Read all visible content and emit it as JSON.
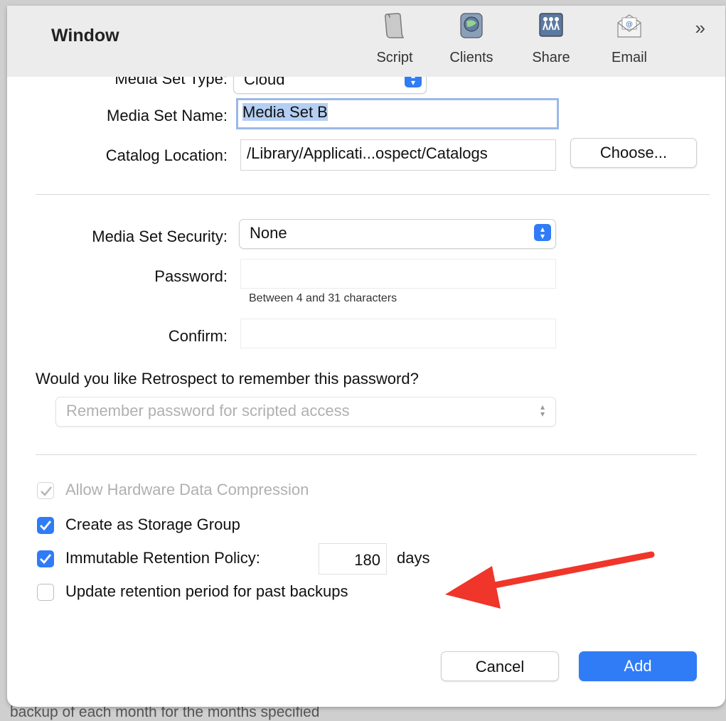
{
  "background_text": "backup of each month for the months specified",
  "window": {
    "title": "Window"
  },
  "toolbar": {
    "items": [
      {
        "label": "Script",
        "icon": "script-scroll-icon"
      },
      {
        "label": "Clients",
        "icon": "clients-globe-icon"
      },
      {
        "label": "Share",
        "icon": "share-people-icon"
      },
      {
        "label": "Email",
        "icon": "email-envelope-icon"
      }
    ],
    "more_label": "»"
  },
  "form": {
    "media_set_type": {
      "label": "Media Set Type:",
      "value": "Cloud"
    },
    "media_set_name": {
      "label": "Media Set Name:",
      "value": "Media Set B"
    },
    "catalog_location": {
      "label": "Catalog Location:",
      "value": "/Library/Applicati...ospect/Catalogs",
      "button": "Choose..."
    },
    "security": {
      "label": "Media Set Security:",
      "value": "None"
    },
    "password": {
      "label": "Password:",
      "value": "",
      "hint": "Between 4 and 31 characters"
    },
    "confirm": {
      "label": "Confirm:",
      "value": ""
    },
    "remember_question": "Would you like Retrospect to remember this password?",
    "remember_select": {
      "value": "Remember password for scripted access"
    },
    "checkboxes": {
      "hardware_compression": {
        "label": "Allow Hardware Data Compression",
        "checked": true,
        "disabled": true
      },
      "storage_group": {
        "label": "Create as Storage Group",
        "checked": true
      },
      "immutable": {
        "label": "Immutable Retention Policy:",
        "checked": true
      },
      "update_retention": {
        "label": "Update retention period for past backups",
        "checked": false
      }
    },
    "retention_days": {
      "value": "180",
      "unit": "days"
    }
  },
  "buttons": {
    "cancel": "Cancel",
    "add": "Add"
  },
  "colors": {
    "accent": "#2f7cf6",
    "annotation_arrow": "#f0352a"
  }
}
